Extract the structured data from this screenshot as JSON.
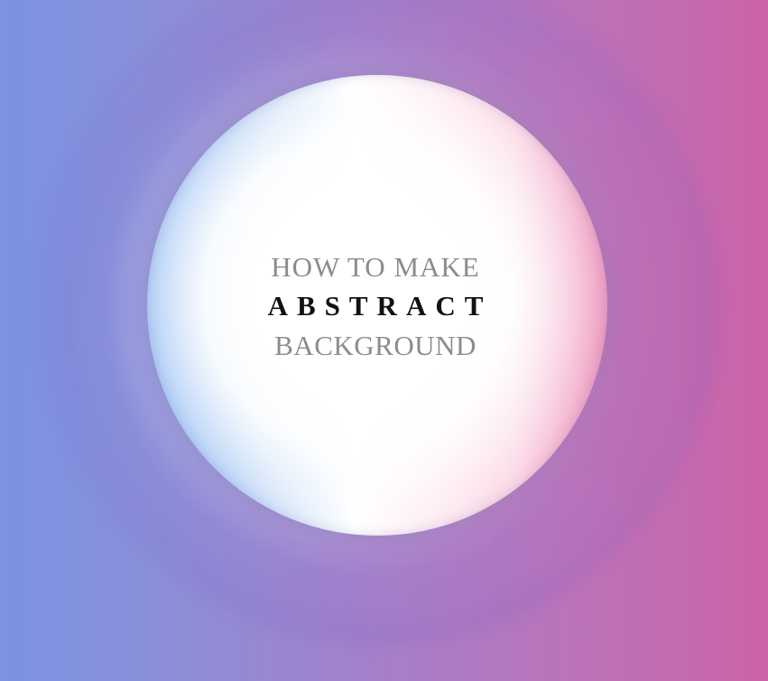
{
  "hero": {
    "line1": "HOW TO MAKE",
    "line2": "ABSTRACT",
    "line3": "BACKGROUND"
  },
  "colors": {
    "background_left": "#7b93e2",
    "background_center": "#a67fc9",
    "background_right": "#cc63a8",
    "orb_center": "#ffffff",
    "orb_left_edge": "#7fb0f0",
    "orb_right_edge": "#ef9bc0",
    "subtitle_text": "#8c8c8c",
    "title_text": "#111111"
  }
}
